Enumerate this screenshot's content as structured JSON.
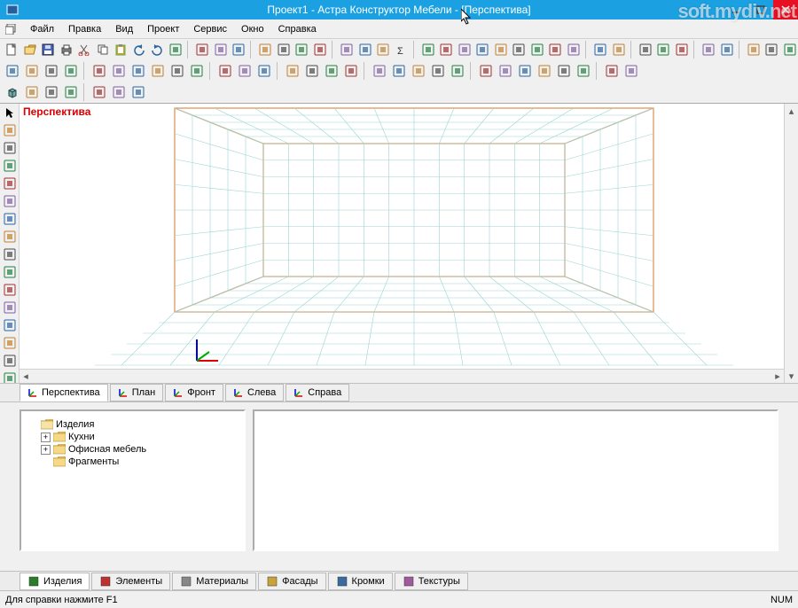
{
  "title": "Проект1 - Астра Конструктор Мебели - [Перспектива]",
  "watermark": "soft.mydiv.net",
  "menu": {
    "items": [
      "Файл",
      "Правка",
      "Вид",
      "Проект",
      "Сервис",
      "Окно",
      "Справка"
    ]
  },
  "viewport_label": "Перспектива",
  "view_tabs": {
    "items": [
      "Перспектива",
      "План",
      "Фронт",
      "Слева",
      "Справа"
    ],
    "active": 0
  },
  "tree": {
    "root": "Изделия",
    "children": [
      {
        "label": "Кухни",
        "expandable": true
      },
      {
        "label": "Офисная мебель",
        "expandable": true
      },
      {
        "label": "Фрагменты",
        "expandable": false
      }
    ]
  },
  "bottom_tabs": {
    "items": [
      "Изделия",
      "Элементы",
      "Материалы",
      "Фасады",
      "Кромки",
      "Текстуры"
    ],
    "active": 0
  },
  "status": {
    "left": "Для справки нажмите F1",
    "right": "NUM"
  },
  "toolbar_row1_names": [
    "new-file",
    "open-file",
    "save-file",
    "print",
    "cut",
    "copy",
    "paste",
    "undo",
    "redo",
    "delete",
    "sep",
    "panel-toggle",
    "nav-back",
    "nav-fwd",
    "sep",
    "shape-a",
    "shape-b",
    "shape-c",
    "shape-d",
    "sep",
    "align-left",
    "align-right",
    "align-top",
    "sum",
    "sep",
    "grid-a",
    "grid-b",
    "grid-c",
    "zoom-in",
    "zoom-out",
    "zoom-fit",
    "pan",
    "target",
    "select",
    "sep",
    "win-cascade",
    "win-tile",
    "sep",
    "cube-solid",
    "cube-wire",
    "layers",
    "sep",
    "color-a",
    "color-b",
    "sep",
    "misc-1",
    "misc-2",
    "misc-3"
  ],
  "toolbar_row2_names": [
    "align-1",
    "align-2",
    "align-3",
    "align-4",
    "sep",
    "dist-1",
    "dist-2",
    "dist-3",
    "dist-4",
    "dist-5",
    "dist-6",
    "sep",
    "rot-1",
    "rot-2",
    "rot-3",
    "sep",
    "conn-1",
    "conn-2",
    "conn-3",
    "conn-4",
    "sep",
    "group-1",
    "group-2",
    "group-3",
    "group-4",
    "group-5",
    "sep",
    "grid-s1",
    "grid-s2",
    "grid-s3",
    "grid-s4",
    "grid-s5",
    "grid-s6",
    "sep",
    "snap-1",
    "snap-2"
  ],
  "toolbar_row3_names": [
    "obj-cube",
    "obj-prism",
    "obj-cone",
    "obj-pyramid",
    "sep",
    "edit-1",
    "edit-2",
    "edit-3"
  ],
  "left_toolbar_names": [
    "pointer",
    "wand",
    "box-2d",
    "rotate-3d",
    "measure",
    "cross",
    "line-h",
    "line-v",
    "arc-1",
    "arc-2",
    "arc-3",
    "circle",
    "rect-sel",
    "lasso",
    "text-tool",
    "anno"
  ],
  "bottom_tab_colors": [
    "#2a7e2a",
    "#c03030",
    "#888888",
    "#caa23a",
    "#3a6aa0",
    "#a05aa0"
  ]
}
